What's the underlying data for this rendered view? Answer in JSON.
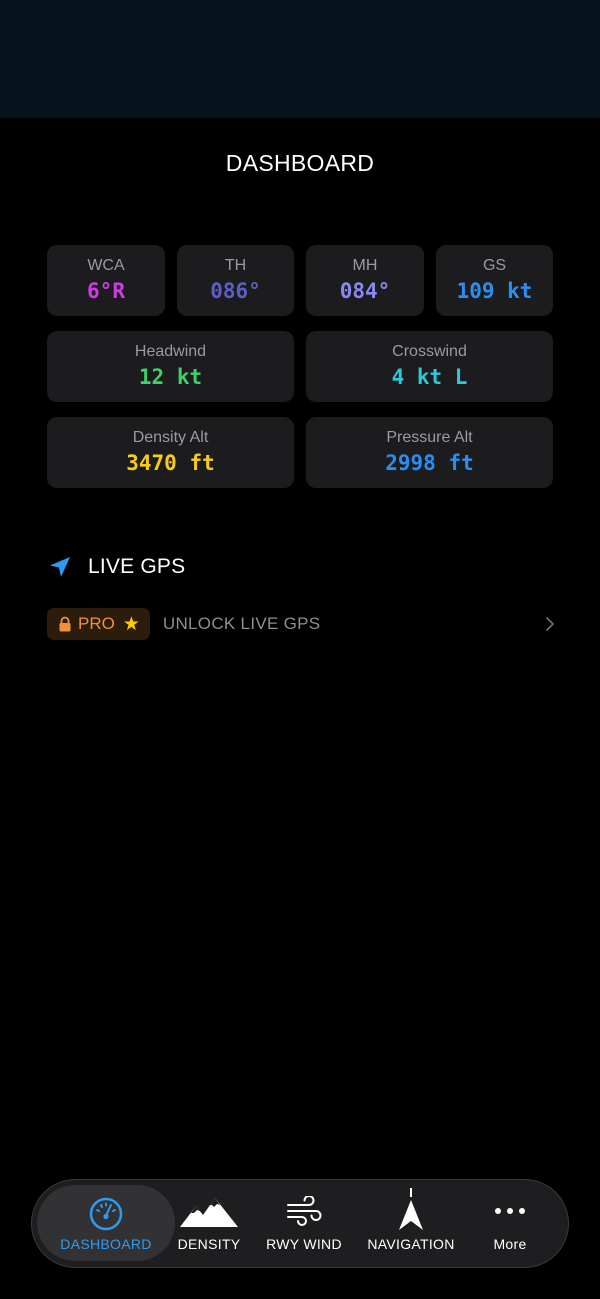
{
  "page": {
    "title": "DASHBOARD"
  },
  "cards_row1": [
    {
      "label": "WCA",
      "value": "6°R",
      "color": "#d23ae8"
    },
    {
      "label": "TH",
      "value": "086°",
      "color": "#5c5fc4"
    },
    {
      "label": "MH",
      "value": "084°",
      "color": "#8a87f0"
    },
    {
      "label": "GS",
      "value": "109 kt",
      "color": "#2b8ff0"
    }
  ],
  "cards_row2": [
    {
      "label": "Headwind",
      "value": "12 kt",
      "color": "#3ed06a"
    },
    {
      "label": "Crosswind",
      "value": "4 kt L",
      "color": "#30c8d8"
    }
  ],
  "cards_row3": [
    {
      "label": "Density Alt",
      "value": "3470 ft",
      "color": "#f5cc1e"
    },
    {
      "label": "Pressure Alt",
      "value": "2998 ft",
      "color": "#2b8ff0"
    }
  ],
  "live_gps": {
    "title": "LIVE GPS",
    "pro_label": "PRO",
    "unlock_text": "UNLOCK LIVE GPS",
    "icon": "location-arrow-icon"
  },
  "tabbar": {
    "active": "DASHBOARD",
    "items": [
      {
        "label": "DASHBOARD",
        "icon": "gauge-icon"
      },
      {
        "label": "DENSITY",
        "icon": "mountains-icon"
      },
      {
        "label": "RWY WIND",
        "icon": "wind-icon"
      },
      {
        "label": "NAVIGATION",
        "icon": "navigation-arrow-icon"
      },
      {
        "label": "More",
        "icon": "more-dots-icon"
      }
    ]
  },
  "colors": {
    "accent": "#2f9bf0",
    "card_bg": "#1c1c1e",
    "pro_orange": "#f0913b",
    "star_yellow": "#ffcc00"
  }
}
